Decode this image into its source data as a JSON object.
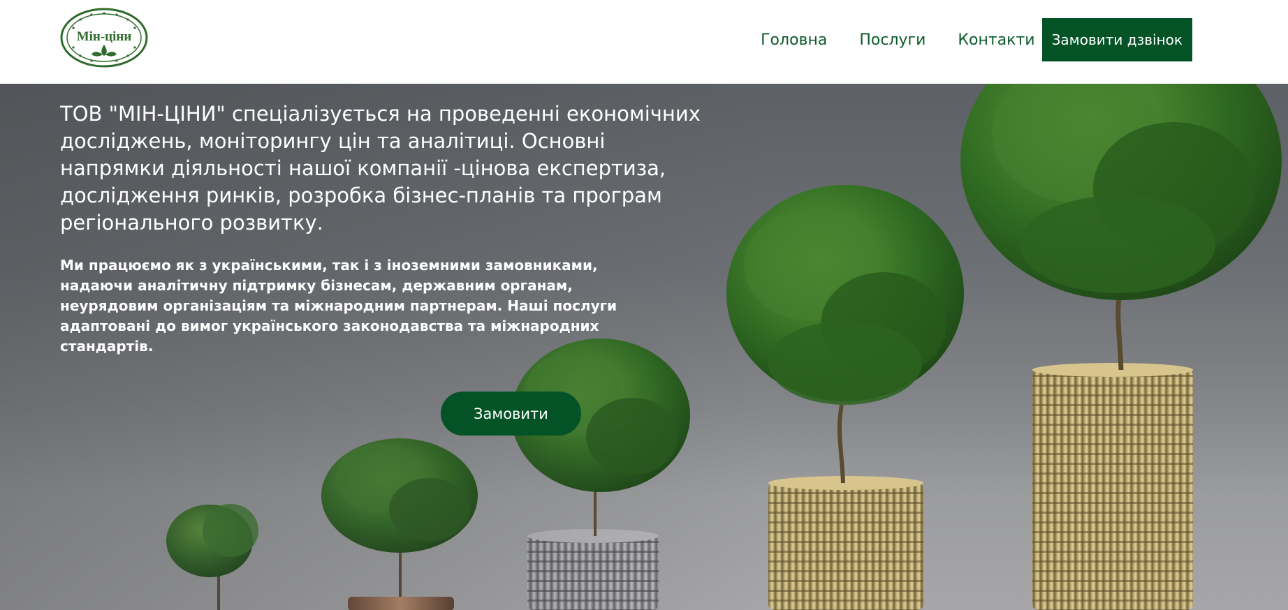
{
  "header": {
    "logo_text": "Мін-ціни",
    "nav": [
      {
        "label": "Головна"
      },
      {
        "label": "Послуги"
      },
      {
        "label": "Контакти"
      }
    ],
    "cta_label": "Замовити дзвінок"
  },
  "hero": {
    "title": "ТОВ \"МІН-ЦІНИ\" спеціалізується на проведенні економічних досліджень, моніторингу цін та аналітиці. Основні напрямки діяльності нашої компанії -цінова експертиза, дослідження ринків, розробка бізнес-планів та програм регіонального розвитку.",
    "text": "Ми працюємо як з українськими, так і з іноземними замовниками, надаючи аналітичну підтримку бізнесам, державним органам, неурядовим організаціям та міжнародним партнерам. Наші послуги адаптовані до вимог українського законодавства та міжнародних стандартів.",
    "button_label": "Замовити"
  },
  "colors": {
    "brand_green": "#035326",
    "nav_text": "#0d5a2a",
    "hero_bg": "#6c6f73"
  }
}
